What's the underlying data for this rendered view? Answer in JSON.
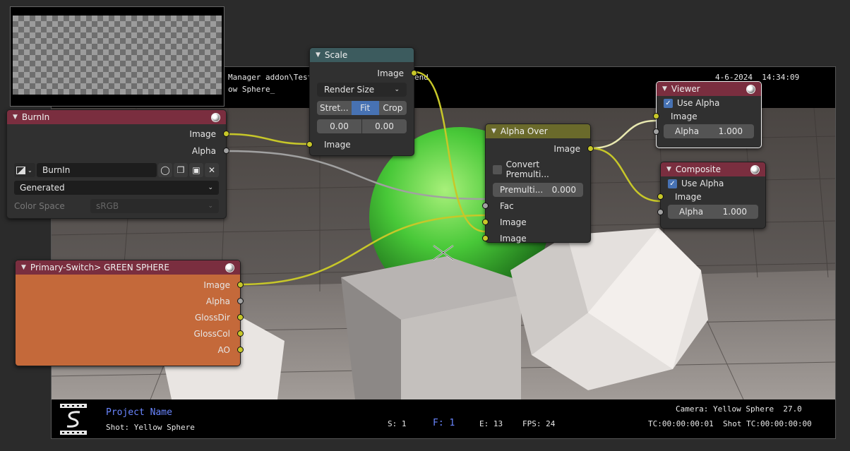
{
  "hud": {
    "path": "Manager addon\\Test",
    "path_tail": "end",
    "camera_line2": "ow Sphere_",
    "datetime": "4-6-2024  14:34:09",
    "project_name": "Project Name",
    "shot": "Shot: Yellow Sphere",
    "frame_s": "S: 1",
    "frame_f": "F: 1",
    "frame_e": "E: 13",
    "fps": "FPS: 24",
    "camera": "Camera: Yellow Sphere  27.0",
    "timecode": "TC:00:00:00:01  Shot TC:00:00:00:00"
  },
  "nodes": {
    "scale": {
      "title": "Scale",
      "out_image": "Image",
      "space": "Render Size",
      "modes": [
        "Stret...",
        "Fit",
        "Crop"
      ],
      "offset_x": "0.00",
      "offset_y": "0.00",
      "in_image": "Image"
    },
    "burnin": {
      "title": "BurnIn",
      "out_image": "Image",
      "out_alpha": "Alpha",
      "image_name": "BurnIn",
      "source": "Generated",
      "color_space_label": "Color Space",
      "color_space_value": "sRGB"
    },
    "alpha_over": {
      "title": "Alpha Over",
      "out_image": "Image",
      "convert_label": "Convert Premulti...",
      "premul_label": "Premulti...",
      "premul_value": "0.000",
      "in_fac": "Fac",
      "in_image1": "Image",
      "in_image2": "Image"
    },
    "viewer": {
      "title": "Viewer",
      "use_alpha": "Use Alpha",
      "in_image": "Image",
      "alpha_label": "Alpha",
      "alpha_value": "1.000"
    },
    "composite": {
      "title": "Composite",
      "use_alpha": "Use Alpha",
      "in_image": "Image",
      "alpha_label": "Alpha",
      "alpha_value": "1.000"
    },
    "render_layers": {
      "title": "Primary-Switch> GREEN SPHERE",
      "outputs": [
        "Image",
        "Alpha",
        "GlossDir",
        "GlossCol",
        "AO"
      ]
    }
  },
  "colors": {
    "group_header": "#7a2e3f",
    "scale_header": "#3c5b5e",
    "mix_header": "#6a6a2b",
    "render_layer_body": "#c4693a",
    "socket_color": "#c7c729",
    "socket_alpha": "#a1a1a1"
  }
}
